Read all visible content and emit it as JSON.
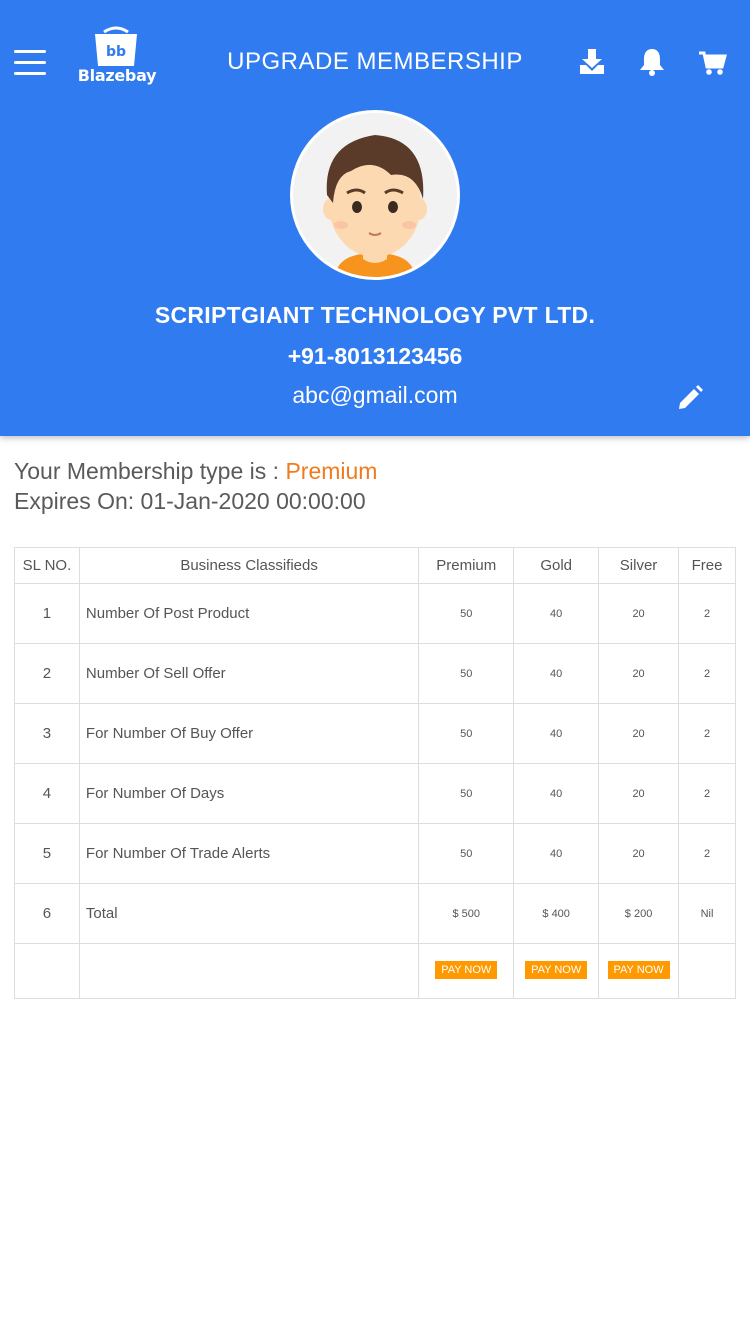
{
  "header": {
    "title": "UPGRADE MEMBERSHIP",
    "logo_text": "Blazebay",
    "icons": [
      "menu-icon",
      "download-icon",
      "bell-icon",
      "cart-icon"
    ],
    "background": "#2f7bef"
  },
  "profile": {
    "company": "SCRIPTGIANT TECHNOLOGY PVT LTD.",
    "phone": "+91-8013123456",
    "email": "abc@gmail.com"
  },
  "membership": {
    "prefix": "Your Membership type is : ",
    "type": "Premium",
    "expires": "Expires On: 01-Jan-2020 00:00:00",
    "accent": "#f07b1e"
  },
  "table": {
    "headers": [
      "SL NO.",
      "Business Classifieds",
      "Premium",
      "Gold",
      "Silver",
      "Free"
    ],
    "rows": [
      {
        "sl": "1",
        "desc": "Number Of Post Product",
        "premium": "50",
        "gold": "40",
        "silver": "20",
        "free": "2"
      },
      {
        "sl": "2",
        "desc": "Number Of Sell Offer",
        "premium": "50",
        "gold": "40",
        "silver": "20",
        "free": "2"
      },
      {
        "sl": "3",
        "desc": "For Number Of Buy Offer",
        "premium": "50",
        "gold": "40",
        "silver": "20",
        "free": "2"
      },
      {
        "sl": "4",
        "desc": "For Number Of Days",
        "premium": "50",
        "gold": "40",
        "silver": "20",
        "free": "2"
      },
      {
        "sl": "5",
        "desc": "For Number Of Trade Alerts",
        "premium": "50",
        "gold": "40",
        "silver": "20",
        "free": "2"
      },
      {
        "sl": "6",
        "desc": "Total",
        "premium": "$ 500",
        "gold": "$ 400",
        "silver": "$ 200",
        "free": "Nil"
      }
    ],
    "pay_label": "PAY NOW",
    "pay_color": "#ff9900"
  }
}
